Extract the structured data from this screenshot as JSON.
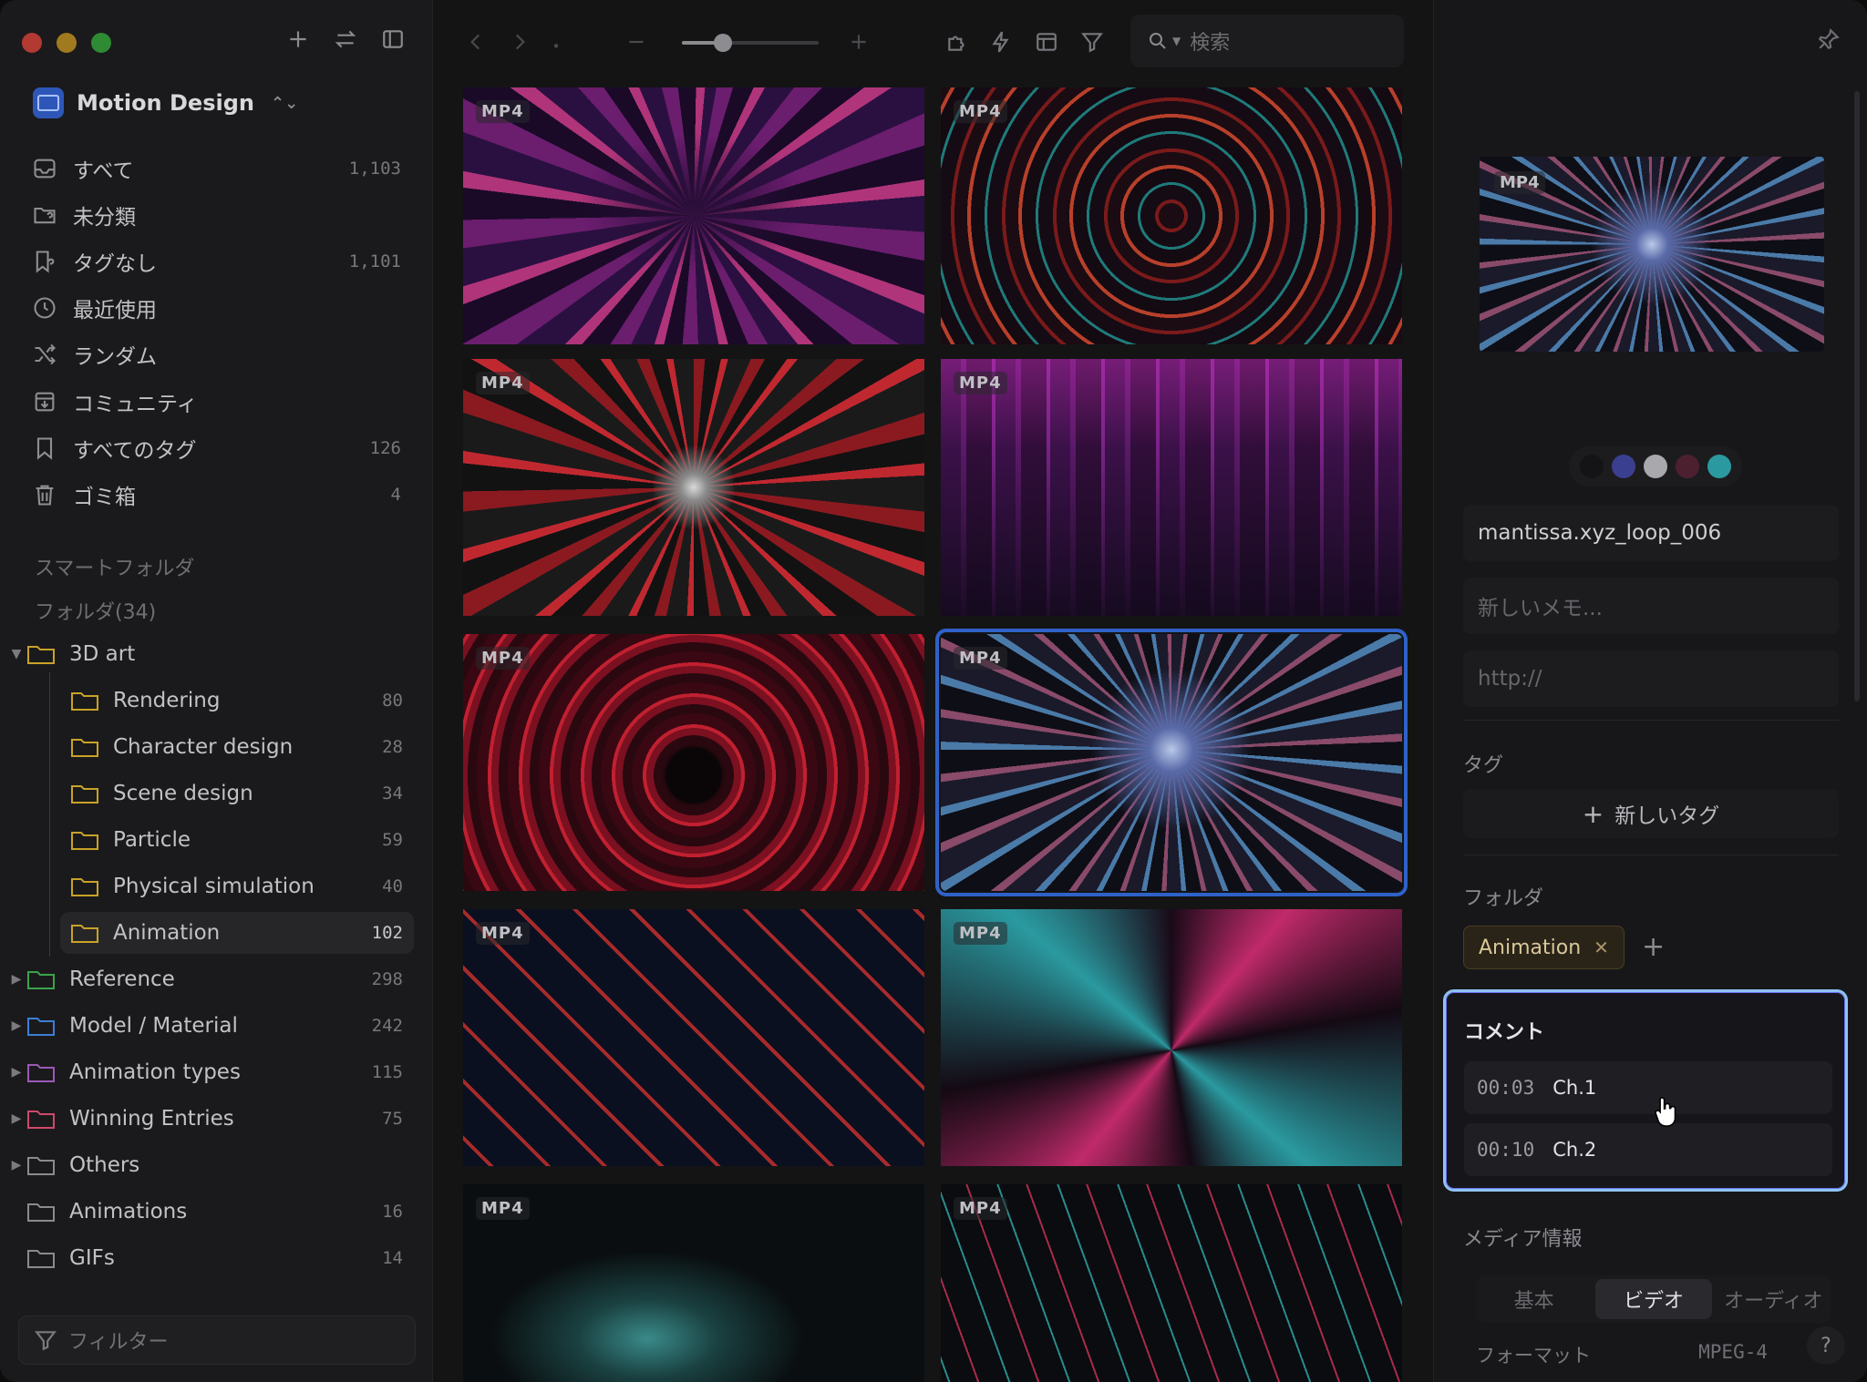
{
  "sidebar": {
    "library_name": "Motion Design",
    "items": [
      {
        "label": "すべて",
        "count": "1,103",
        "icon": "inbox-icon"
      },
      {
        "label": "未分類",
        "count": "",
        "icon": "folder-question-icon"
      },
      {
        "label": "タグなし",
        "count": "1,101",
        "icon": "tag-question-icon"
      },
      {
        "label": "最近使用",
        "count": "",
        "icon": "clock-icon"
      },
      {
        "label": "ランダム",
        "count": "",
        "icon": "shuffle-icon"
      },
      {
        "label": "コミュニティ",
        "count": "",
        "icon": "download-box-icon"
      },
      {
        "label": "すべてのタグ",
        "count": "126",
        "icon": "bookmark-icon"
      },
      {
        "label": "ゴミ箱",
        "count": "4",
        "icon": "trash-icon"
      }
    ],
    "smart_folder_label": "スマートフォルダ",
    "folders_label": "フォルダ(34)",
    "folders": [
      {
        "label": "3D art",
        "count": "",
        "color": "#c9a227"
      },
      {
        "label": "Rendering",
        "count": "80",
        "color": "#c9a227"
      },
      {
        "label": "Character design",
        "count": "28",
        "color": "#c9a227"
      },
      {
        "label": "Scene design",
        "count": "34",
        "color": "#c9a227"
      },
      {
        "label": "Particle",
        "count": "59",
        "color": "#c9a227"
      },
      {
        "label": "Physical simulation",
        "count": "40",
        "color": "#c9a227"
      },
      {
        "label": "Animation",
        "count": "102",
        "color": "#c9a227"
      },
      {
        "label": "Reference",
        "count": "298",
        "color": "#3aa34a"
      },
      {
        "label": "Model / Material",
        "count": "242",
        "color": "#3b7fd6"
      },
      {
        "label": "Animation types",
        "count": "115",
        "color": "#9b59b6"
      },
      {
        "label": "Winning Entries",
        "count": "75",
        "color": "#d0486a"
      },
      {
        "label": "Others",
        "count": "",
        "color": "#8a8a8f"
      },
      {
        "label": "Animations",
        "count": "16",
        "color": "#8a8a8f"
      },
      {
        "label": "GIFs",
        "count": "14",
        "color": "#8a8a8f"
      }
    ],
    "filter_placeholder": "フィルター"
  },
  "toolbar": {
    "search_placeholder": "検索",
    "zoom_level": 0.3
  },
  "grid": {
    "badge": "MP4",
    "items": [
      {
        "format": "MP4"
      },
      {
        "format": "MP4"
      },
      {
        "format": "MP4"
      },
      {
        "format": "MP4"
      },
      {
        "format": "MP4"
      },
      {
        "format": "MP4"
      },
      {
        "format": "MP4"
      },
      {
        "format": "MP4"
      },
      {
        "format": "MP4"
      },
      {
        "format": "MP4"
      }
    ]
  },
  "inspector": {
    "preview_badge": "MP4",
    "palette": [
      "#141416",
      "#3b3f8f",
      "#a9a9ad",
      "#4d2030",
      "#2a9aa0"
    ],
    "name": "mantissa.xyz_loop_006",
    "memo_placeholder": "新しいメモ...",
    "url_placeholder": "http://",
    "tags_label": "タグ",
    "new_tag_label": "新しいタグ",
    "folder_label": "フォルダ",
    "folder_chip": "Animation",
    "comment_label": "コメント",
    "comments": [
      {
        "time": "00:03",
        "text": "Ch.1"
      },
      {
        "time": "00:10",
        "text": "Ch.2"
      }
    ],
    "media_label": "メディア情報",
    "tabs": [
      "基本",
      "ビデオ",
      "オーディオ"
    ],
    "active_tab": "ビデオ",
    "format_key": "フォーマット",
    "format_value": "MPEG-4",
    "help": "?"
  }
}
